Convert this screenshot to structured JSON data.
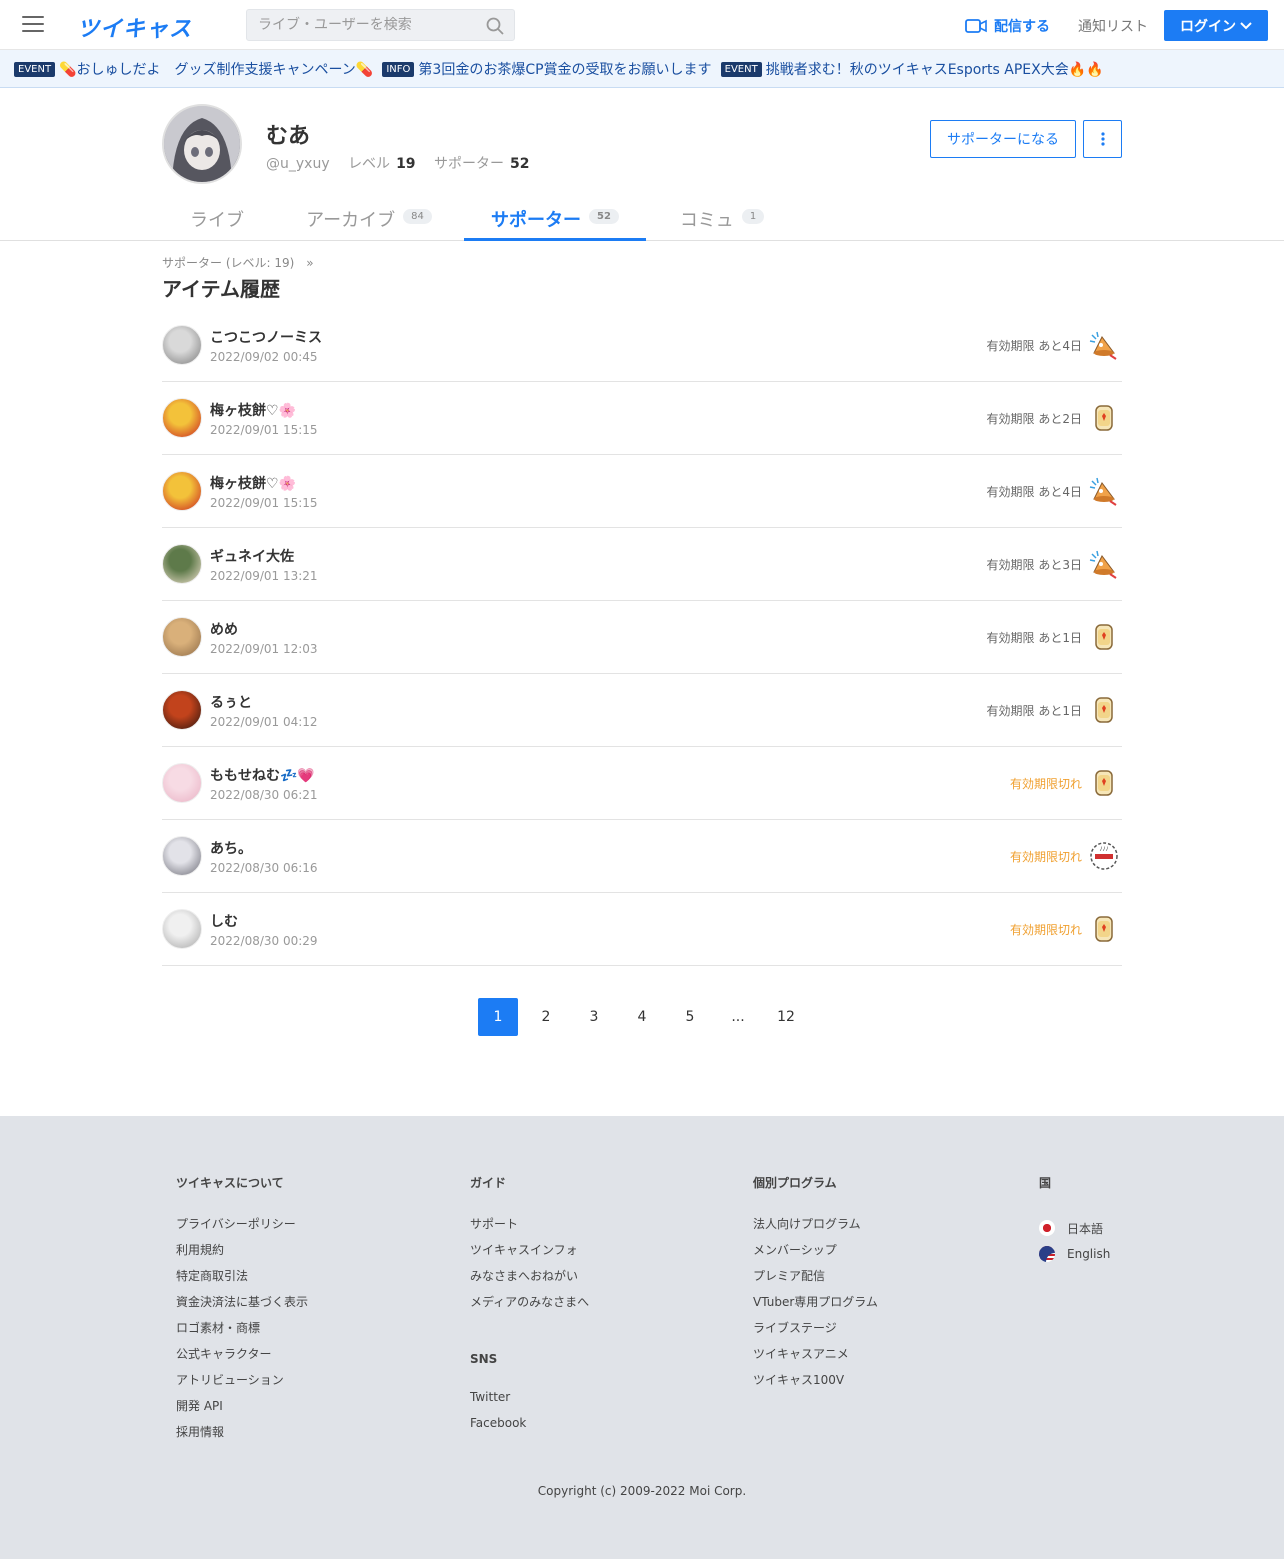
{
  "header": {
    "logo": "ツイキャス",
    "search_placeholder": "ライブ・ユーザーを検索",
    "broadcast": "配信する",
    "notify": "通知リスト",
    "login": "ログイン"
  },
  "ticker": [
    {
      "badge": "EVENT",
      "text": "💊おしゅしだよ　グッズ制作支援キャンペーン💊"
    },
    {
      "badge": "INFO",
      "text": "第3回金のお茶爆CP賞金の受取をお願いします"
    },
    {
      "badge": "EVENT",
      "text": "挑戦者求む！秋のツイキャスEsports APEX大会🔥🔥"
    }
  ],
  "profile": {
    "name": "むあ",
    "handle": "@u_yxuy",
    "level_label": "レベル",
    "level": "19",
    "supporter_label": "サポーター",
    "supporters": "52",
    "support_button": "サポーターになる"
  },
  "tabs": [
    {
      "label": "ライブ",
      "count": ""
    },
    {
      "label": "アーカイブ",
      "count": "84"
    },
    {
      "label": "サポーター",
      "count": "52"
    },
    {
      "label": "コミュ",
      "count": "1"
    }
  ],
  "breadcrumb": "サポーター (レベル: 19)　»",
  "page_title": "アイテム履歴",
  "items": [
    {
      "name": "こつこつノーミス",
      "date": "2022/09/02 00:45",
      "status": "有効期限 あと4日",
      "expired": false,
      "item_icon": "megaphone-icon",
      "avatar_colors": [
        "#d9d9d9",
        "#7a7a7a"
      ]
    },
    {
      "name": "梅ヶ枝餅♡🌸",
      "date": "2022/09/01 15:15",
      "status": "有効期限 あと2日",
      "expired": false,
      "item_icon": "tea-cup-icon",
      "avatar_colors": [
        "#f3c23a",
        "#c8201e"
      ]
    },
    {
      "name": "梅ヶ枝餅♡🌸",
      "date": "2022/09/01 15:15",
      "status": "有効期限 あと4日",
      "expired": false,
      "item_icon": "megaphone-icon",
      "avatar_colors": [
        "#f3c23a",
        "#c8201e"
      ]
    },
    {
      "name": "ギュネイ大佐",
      "date": "2022/09/01 13:21",
      "status": "有効期限 あと3日",
      "expired": false,
      "item_icon": "megaphone-icon",
      "avatar_colors": [
        "#5e7a4a",
        "#f1e2cf"
      ]
    },
    {
      "name": "めめ",
      "date": "2022/09/01 12:03",
      "status": "有効期限 あと1日",
      "expired": false,
      "item_icon": "tea-cup-icon",
      "avatar_colors": [
        "#d9b07a",
        "#8d6a45"
      ]
    },
    {
      "name": "るぅと",
      "date": "2022/09/01 04:12",
      "status": "有効期限 あと1日",
      "expired": false,
      "item_icon": "tea-cup-icon",
      "avatar_colors": [
        "#c2431c",
        "#2a130d"
      ]
    },
    {
      "name": "ももせねむ💤💗",
      "date": "2022/08/30 06:21",
      "status": "有効期限切れ",
      "expired": true,
      "item_icon": "tea-cup-icon",
      "avatar_colors": [
        "#f7dbe4",
        "#e9b0c3"
      ]
    },
    {
      "name": "あち。",
      "date": "2022/08/30 06:16",
      "status": "有効期限切れ",
      "expired": true,
      "item_icon": "stamp-icon",
      "avatar_colors": [
        "#e2e2e8",
        "#6b6b75"
      ]
    },
    {
      "name": "しむ",
      "date": "2022/08/30 00:29",
      "status": "有効期限切れ",
      "expired": true,
      "item_icon": "tea-cup-icon",
      "avatar_colors": [
        "#f0f0f0",
        "#a5a5a5"
      ]
    }
  ],
  "pagination": [
    "1",
    "2",
    "3",
    "4",
    "5",
    "...",
    "12"
  ],
  "footer": {
    "col1": {
      "title": "ツイキャスについて",
      "links": [
        "プライバシーポリシー",
        "利用規約",
        "特定商取引法",
        "資金決済法に基づく表示",
        "ロゴ素材・商標",
        "公式キャラクター",
        "アトリビューション",
        "開発 API",
        "採用情報"
      ]
    },
    "col2": {
      "title": "ガイド",
      "links": [
        "サポート",
        "ツイキャスインフォ",
        "みなさまへおねがい",
        "メディアのみなさまへ"
      ]
    },
    "col2b": {
      "title": "SNS",
      "links": [
        "Twitter",
        "Facebook"
      ]
    },
    "col3": {
      "title": "個別プログラム",
      "links": [
        "法人向けプログラム",
        "メンバーシップ",
        "プレミア配信",
        "VTuber専用プログラム",
        "ライブステージ",
        "ツイキャスアニメ",
        "ツイキャス100V"
      ]
    },
    "col4": {
      "title": "国",
      "langs": [
        "日本語",
        "English"
      ]
    },
    "copyright": "Copyright (c) 2009-2022 Moi Corp."
  },
  "colors": {
    "accent": "#1c7cf4",
    "expired": "#f0a030",
    "footer_bg": "#e0e3e8"
  }
}
